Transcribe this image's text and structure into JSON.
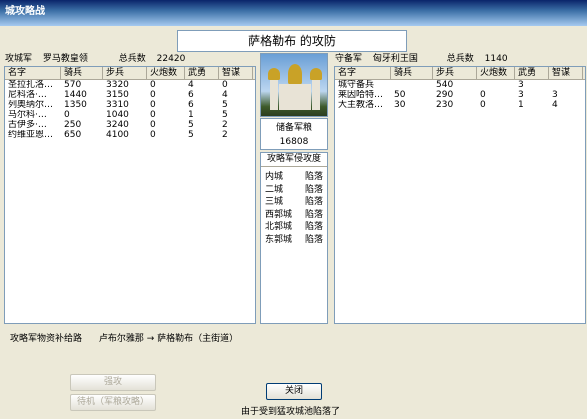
{
  "window": {
    "title": "城攻略战"
  },
  "heading": "萨格勒布 的攻防",
  "attacker": {
    "side_label": "攻城军",
    "commander": "罗马教皇领",
    "total_label": "总兵数",
    "total": "22420",
    "columns": [
      "名字",
      "骑兵",
      "步兵",
      "火炮数",
      "武勇",
      "智谋"
    ],
    "rows": [
      [
        "圣拉扎洛…",
        "570",
        "3320",
        "0",
        "4",
        "0"
      ],
      [
        "尼科洛·…",
        "1440",
        "3150",
        "0",
        "6",
        "4"
      ],
      [
        "列奥纳尔…",
        "1350",
        "3310",
        "0",
        "6",
        "5"
      ],
      [
        "马尔科·…",
        "0",
        "1040",
        "0",
        "1",
        "5"
      ],
      [
        "古伊多·…",
        "250",
        "3240",
        "0",
        "5",
        "2"
      ],
      [
        "约维亚恩…",
        "650",
        "4100",
        "0",
        "5",
        "2"
      ]
    ]
  },
  "defender": {
    "side_label": "守备军",
    "commander": "匈牙利王国",
    "total_label": "总兵数",
    "total": "1140",
    "columns": [
      "名字",
      "骑兵",
      "步兵",
      "火炮数",
      "武勇",
      "智谋"
    ],
    "rows": [
      [
        "城守备兵",
        "",
        "540",
        "",
        "3",
        ""
      ],
      [
        "莱因哈特…",
        "50",
        "290",
        "0",
        "3",
        "3"
      ],
      [
        "大主教洛…",
        "30",
        "230",
        "0",
        "1",
        "4"
      ]
    ]
  },
  "reserve": {
    "label": "储备军粮",
    "value": "16808"
  },
  "progress": {
    "title": "攻略军侵攻度",
    "items": [
      {
        "area": "内城",
        "state": "陷落"
      },
      {
        "area": "二城",
        "state": "陷落"
      },
      {
        "area": "三城",
        "state": "陷落"
      },
      {
        "area": "西郭城",
        "state": "陷落"
      },
      {
        "area": "北郭城",
        "state": "陷落"
      },
      {
        "area": "东郭城",
        "state": "陷落"
      }
    ]
  },
  "supply": {
    "label": "攻略军物资补给路",
    "route": "卢布尔雅那 → 萨格勒布（主街道）"
  },
  "buttons": {
    "assault": "强攻",
    "wait": "待机（军粮攻略）",
    "close": "关闭"
  },
  "status_text": "由于受到猛攻城池陷落了"
}
